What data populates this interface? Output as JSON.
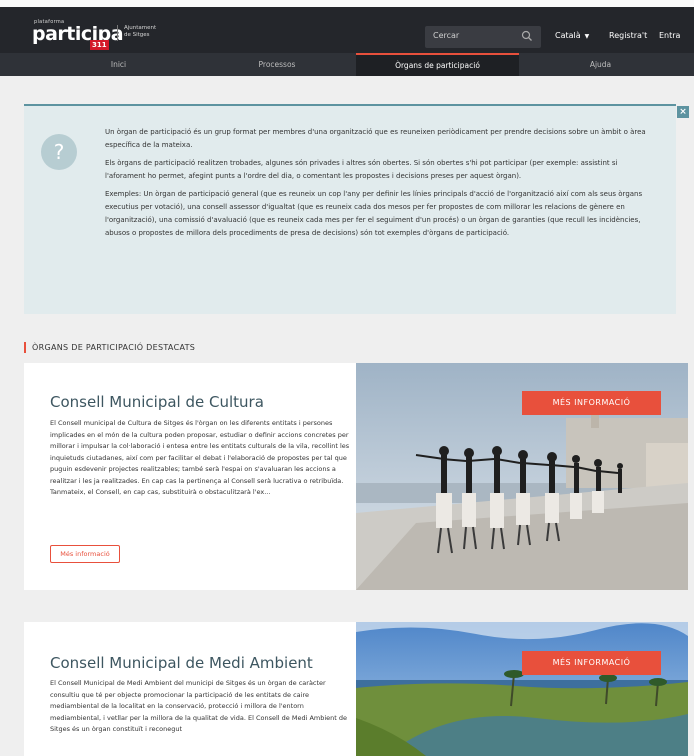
{
  "header": {
    "logo_sup": "plataforma",
    "logo_word": "participa",
    "logo_num": "311",
    "ajuntament_line1": "Ajuntament",
    "ajuntament_line2": "de Sitges",
    "search_placeholder": "Cercar",
    "language": "Català",
    "register": "Registra't",
    "login": "Entra"
  },
  "nav": {
    "tabs": [
      {
        "label": "Inici"
      },
      {
        "label": "Processos"
      },
      {
        "label": "Òrgans de participació"
      },
      {
        "label": "Ajuda"
      }
    ]
  },
  "info": {
    "close": "×",
    "icon": "?",
    "p1": "Un òrgan de participació és un grup format per membres d'una organització que es reuneixen periòdicament per prendre decisions sobre un àmbit o àrea específica de la mateixa.",
    "p2": "Els òrgans de participació realitzen trobades, algunes són privades i altres són obertes. Si són obertes s'hi pot participar (per exemple: assistint si l'aforament ho permet, afegint punts a l'ordre del dia, o comentant les propostes i decisions preses per aquest òrgan).",
    "p3": "Exemples: Un òrgan de participació general (que es reuneix un cop l'any per definir les línies principals d'acció de l'organització així com als seus òrgans executius per votació), una consell assessor d'igualtat (que es reuneix cada dos mesos per fer propostes de com millorar les relacions de gènere en l'organització), una comissió d'avaluació (que es reuneix cada mes per fer el seguiment d'un procés) o un òrgan de garanties (que recull les incidències, abusos o propostes de millora dels procediments de presa de decisions) són tot exemples d'òrgans de participació."
  },
  "section": {
    "title": "ÒRGANS DE PARTICIPACIÓ DESTACATS"
  },
  "cards": [
    {
      "title": "Consell Municipal de Cultura",
      "body": "El Consell municipal de Cultura de Sitges és l'òrgan on les diferents entitats i persones implicades en el món de la cultura poden proposar, estudiar o definir accions concretes per millorar i impulsar la col·laboració i entesa entre les entitats culturals de la vila, recollint les inquietuds ciutadanes, així com per facilitar el debat i l'elaboració de propostes per tal que puguin esdevenir projectes realitzables; també serà l'espai on s'avaluaran les accions a realitzar i les ja realitzades. En cap cas la pertinença al Consell serà lucrativa o retribuïda. Tanmateix, el Consell, en cap cas, substituirà o obstaculitzarà l'ex...",
      "more_small": "Més informació",
      "more_big": "MÉS INFORMACIÓ"
    },
    {
      "title": "Consell Municipal de Medi Ambient",
      "body": "El Consell Municipal de Medi Ambient del municipi de Sitges és un òrgan de caràcter consultiu que té per objecte promocionar la participació de les entitats de caire mediambiental de la localitat en la conservació, protecció i millora de l'entorn mediambiental, i vetllar per la millora de la qualitat de vida. El Consell de Medi Ambient de Sitges és un òrgan constituït i reconegut",
      "more_big": "MÉS INFORMACIÓ"
    }
  ]
}
